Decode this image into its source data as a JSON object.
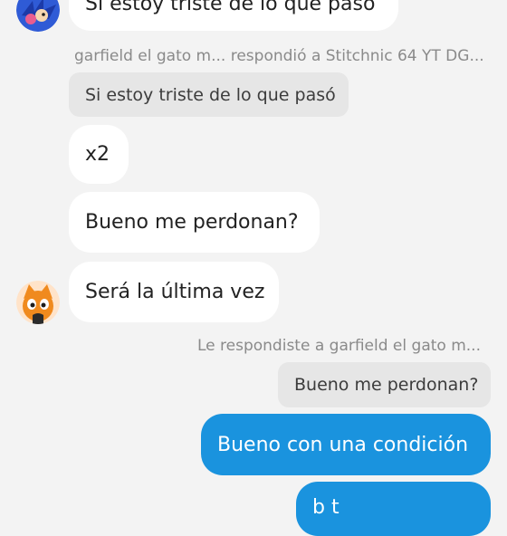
{
  "conversation": {
    "top_message": "Si estoy triste de lo que pasó",
    "reply_meta_1": "garfield el gato m... respondió a Stitchnic 64 YT DG...",
    "quoted_1": "Si estoy triste de lo que pasó",
    "msg_x2": "x2",
    "msg_perdonan": "Bueno me perdonan?",
    "msg_ultima": "Será la última vez",
    "reply_meta_2": "Le respondiste a garfield el gato m...",
    "quoted_2": "Bueno me perdonan?",
    "out_condicion": "Bueno con una condición",
    "out_partial": "b t"
  },
  "avatars": {
    "top": "sonic-avatar-icon",
    "orange": "orange-cat-avatar-icon"
  },
  "colors": {
    "background": "#f3f3f3",
    "incoming_bubble": "#ffffff",
    "quote_bubble": "#e6e6e6",
    "outgoing_bubble": "#1a93de",
    "meta_text": "#8a8a8a"
  }
}
